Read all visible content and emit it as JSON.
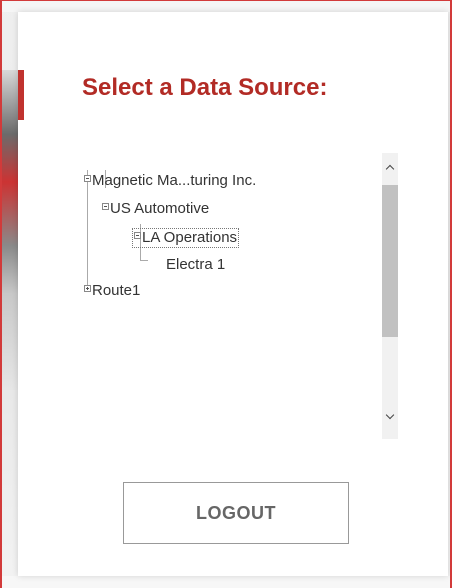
{
  "modal": {
    "title": "Select a Data Source:",
    "accent_color": "#b22b25"
  },
  "tree": {
    "nodes": [
      {
        "label": "Magnetic Ma...turing Inc.",
        "level": 0,
        "expander": "minus",
        "selected": false
      },
      {
        "label": "US Automotive",
        "level": 1,
        "expander": "minus",
        "selected": false
      },
      {
        "label": "LA Operations",
        "level": 2,
        "expander": "minus",
        "selected": true
      },
      {
        "label": "Electra 1",
        "level": 3,
        "expander": "none",
        "selected": false
      },
      {
        "label": "Route1",
        "level": 0,
        "expander": "plus",
        "selected": false
      }
    ]
  },
  "scrollbar": {
    "up_icon": "chevron-up-icon",
    "down_icon": "chevron-down-icon"
  },
  "footer": {
    "logout_label": "LOGOUT"
  }
}
